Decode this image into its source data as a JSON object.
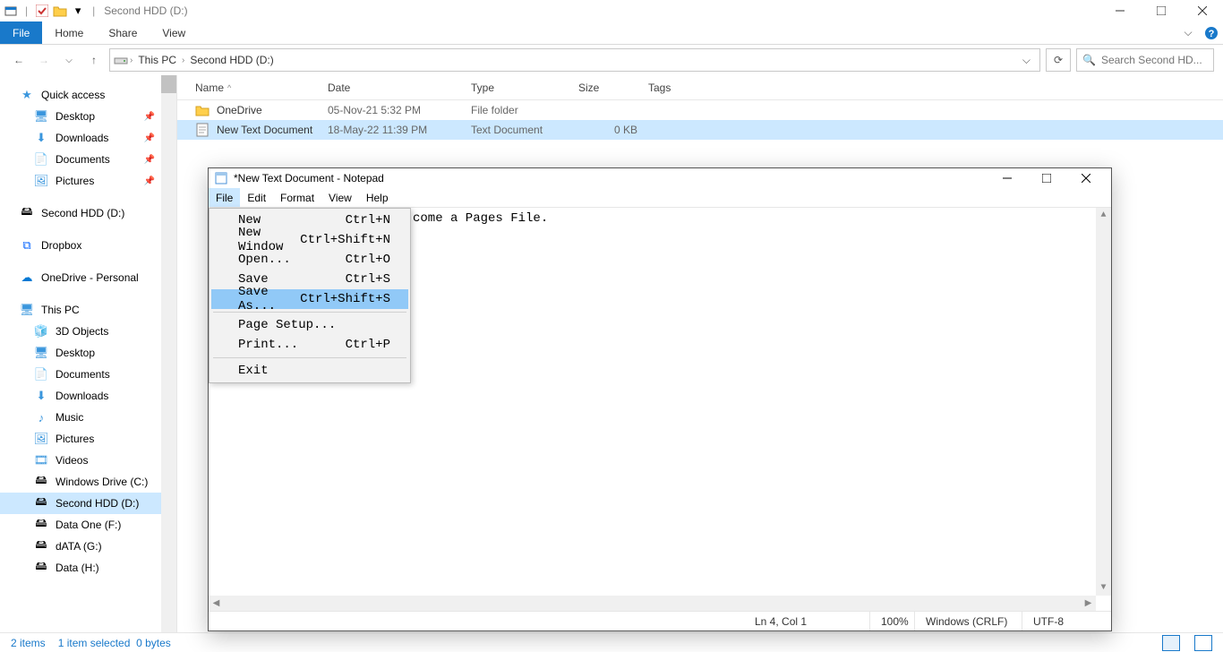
{
  "window_title": "Second HDD (D:)",
  "ribbon": {
    "file": "File",
    "home": "Home",
    "share": "Share",
    "view": "View"
  },
  "breadcrumb": {
    "root": "This PC",
    "path": "Second HDD (D:)"
  },
  "search_placeholder": "Search Second HD...",
  "sidebar": {
    "quick_access": "Quick access",
    "desktop": "Desktop",
    "downloads": "Downloads",
    "documents": "Documents",
    "pictures": "Pictures",
    "second_hdd": "Second HDD (D:)",
    "dropbox": "Dropbox",
    "onedrive": "OneDrive - Personal",
    "this_pc": "This PC",
    "objects3d": "3D Objects",
    "desktop2": "Desktop",
    "documents2": "Documents",
    "downloads2": "Downloads",
    "music": "Music",
    "pictures2": "Pictures",
    "videos": "Videos",
    "win_drive": "Windows Drive (C:)",
    "second_hdd2": "Second HDD (D:)",
    "data_one": "Data One (F:)",
    "data_g": "dATA (G:)",
    "data_h": "Data (H:)"
  },
  "columns": {
    "name": "Name",
    "date": "Date",
    "type": "Type",
    "size": "Size",
    "tags": "Tags"
  },
  "rows": [
    {
      "name": "OneDrive",
      "date": "05-Nov-21 5:32 PM",
      "type": "File folder",
      "size": ""
    },
    {
      "name": "New Text Document",
      "date": "18-May-22 11:39 PM",
      "type": "Text Document",
      "size": "0 KB"
    }
  ],
  "notepad": {
    "title": "*New Text Document - Notepad",
    "menus": {
      "file": "File",
      "edit": "Edit",
      "format": "Format",
      "view": "View",
      "help": "Help"
    },
    "dropdown": [
      {
        "label": "New",
        "accel": "Ctrl+N"
      },
      {
        "label": "New Window",
        "accel": "Ctrl+Shift+N"
      },
      {
        "label": "Open...",
        "accel": "Ctrl+O"
      },
      {
        "label": "Save",
        "accel": "Ctrl+S"
      },
      {
        "label": "Save As...",
        "accel": "Ctrl+Shift+S"
      },
      {
        "sep": true
      },
      {
        "label": "Page Setup...",
        "accel": ""
      },
      {
        "label": "Print...",
        "accel": "Ctrl+P"
      },
      {
        "sep": true
      },
      {
        "label": "Exit",
        "accel": ""
      }
    ],
    "body_visible": "come a Pages File.",
    "status": {
      "pos": "Ln 4, Col 1",
      "zoom": "100%",
      "eol": "Windows (CRLF)",
      "enc": "UTF-8"
    }
  },
  "statusbar": {
    "items": "2 items",
    "selected": "1 item selected",
    "bytes": "0 bytes"
  }
}
